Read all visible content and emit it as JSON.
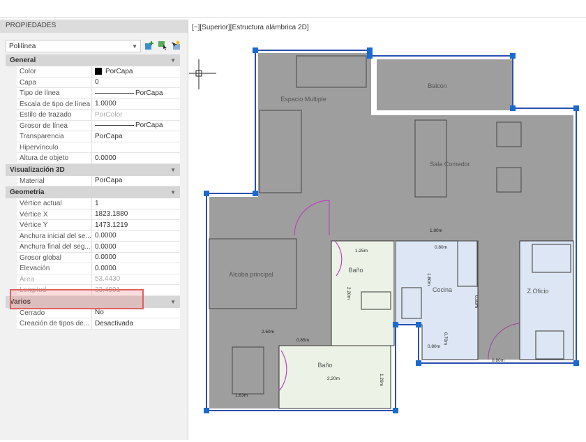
{
  "panel": {
    "title": "PROPIEDADES",
    "selector": "Polilínea"
  },
  "sections": {
    "general": {
      "title": "General",
      "rows": [
        {
          "k": "Color",
          "v": "PorCapa"
        },
        {
          "k": "Capa",
          "v": "0"
        },
        {
          "k": "Tipo de línea",
          "v": "PorCapa"
        },
        {
          "k": "Escala de tipo de línea",
          "v": "1.0000"
        },
        {
          "k": "Estilo de trazado",
          "v": "PorColor"
        },
        {
          "k": "Grosor de línea",
          "v": "PorCapa"
        },
        {
          "k": "Transparencia",
          "v": "PorCapa"
        },
        {
          "k": "Hipervínculo",
          "v": ""
        },
        {
          "k": "Altura de objeto",
          "v": "0.0000"
        }
      ]
    },
    "vis3d": {
      "title": "Visualización 3D",
      "rows": [
        {
          "k": "Material",
          "v": "PorCapa"
        }
      ]
    },
    "geom": {
      "title": "Geometría",
      "rows": [
        {
          "k": "Vértice actual",
          "v": "1"
        },
        {
          "k": "Vértice X",
          "v": "1823.1880"
        },
        {
          "k": "Vértice Y",
          "v": "1473.1219"
        },
        {
          "k": "Anchura inicial del se...",
          "v": "0.0000"
        },
        {
          "k": "Anchura final del seg...",
          "v": "0.0000"
        },
        {
          "k": "Grosor global",
          "v": "0.0000"
        },
        {
          "k": "Elevación",
          "v": "0.0000"
        },
        {
          "k": "Área",
          "v": "53.4430"
        },
        {
          "k": "Longitud",
          "v": "33.4991"
        }
      ]
    },
    "varios": {
      "title": "Varios",
      "rows": [
        {
          "k": "Cerrado",
          "v": "No"
        },
        {
          "k": "Creación de tipos de...",
          "v": "Desactivada"
        }
      ]
    }
  },
  "viewport": {
    "label": "[−][Superior][Estructura alámbrica 2D]"
  },
  "rooms": [
    "Espacio Multiple",
    "Balcon",
    "Sala Comedor",
    "Alcoba principal",
    "Baño",
    "Cocina",
    "Z.Oficio",
    "Baño"
  ],
  "dims": [
    "1.80m",
    "1.25m",
    "0.80m",
    "1.80m",
    "2.20m",
    "0.80m",
    "0.70m",
    "0.80m",
    "2.60m",
    "0.85m",
    "2.20m",
    "1.20m",
    "1.63m",
    "0.80m"
  ],
  "colors": {
    "gray": "#9e9e9e",
    "blue": "#dce6f4",
    "green": "#edf2e6",
    "select": "#2a4fb0",
    "door": "#d040d0"
  }
}
